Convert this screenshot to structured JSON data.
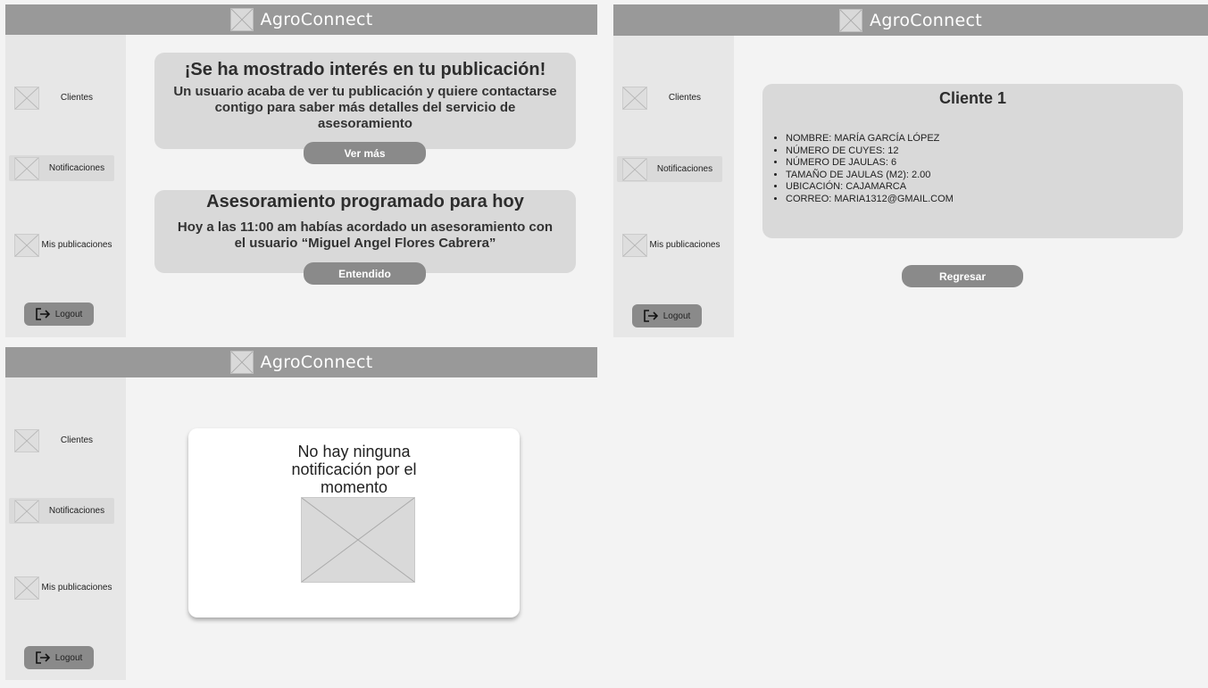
{
  "app": {
    "title": "AgroConnect"
  },
  "icons": {
    "logo": "image-placeholder-icon",
    "nav": "image-placeholder-icon",
    "logout": "logout-arrow-icon"
  },
  "sidebar": {
    "items": [
      {
        "label": "Clientes"
      },
      {
        "label": "Notificaciones"
      },
      {
        "label": "Mis publicaciones"
      }
    ],
    "logout_label": "Logout"
  },
  "screen1": {
    "cards": [
      {
        "title": "¡Se ha mostrado interés en tu publicación!",
        "body": "Un usuario acaba de ver tu publicación y quiere contactarse contigo para saber más detalles del servicio de asesoramiento",
        "button": "Ver más"
      },
      {
        "title": "Asesoramiento programado para hoy",
        "body": "Hoy a las 11:00 am habías acordado un asesoramiento con el usuario “Miguel Angel Flores Cabrera”",
        "button": "Entendido"
      }
    ]
  },
  "screen2": {
    "title": "Cliente 1",
    "details": [
      "NOMBRE: MARÍA GARCÍA LÓPEZ",
      "NÚMERO DE CUYES: 12",
      "NÚMERO DE JAULAS: 6",
      "TAMAÑO DE JAULAS (M2): 2.00",
      "UBICACIÓN: CAJAMARCA",
      "CORREO: MARIA1312@GMAIL.COM"
    ],
    "back_button": "Regresar"
  },
  "screen3": {
    "empty_message": "No hay ninguna notificación por el momento"
  },
  "colors": {
    "header": "#999999",
    "sidebar": "#e7e7e7",
    "card": "#d9d9d9",
    "button": "#8a8a8a",
    "canvas": "#f3f3f3"
  }
}
